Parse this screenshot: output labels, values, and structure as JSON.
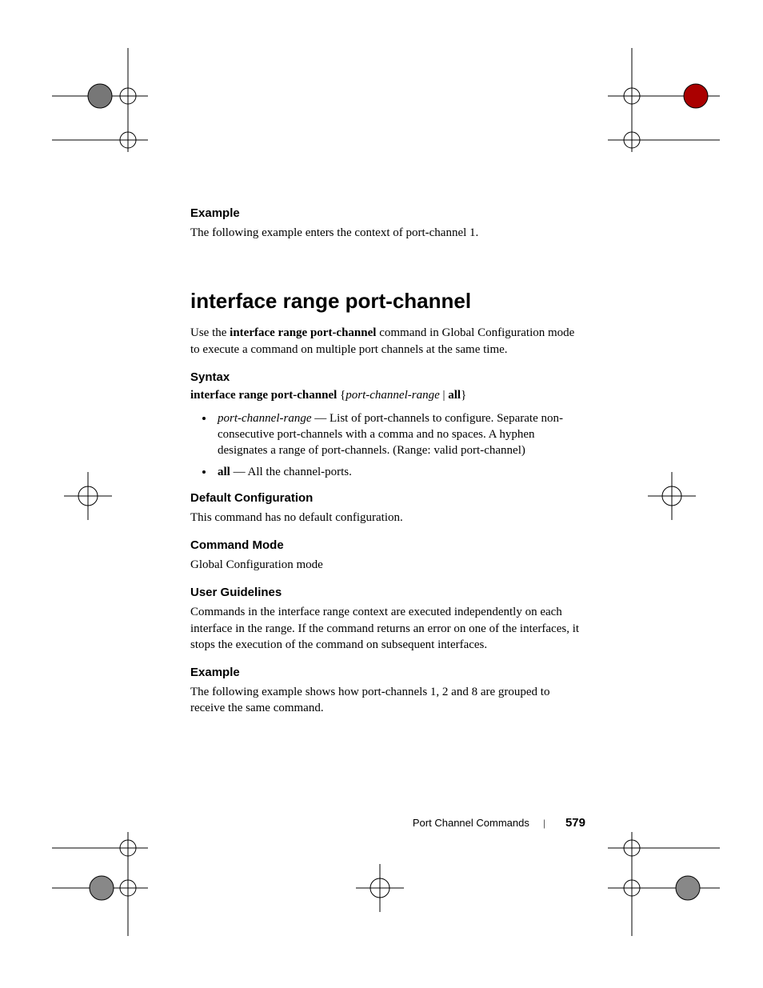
{
  "section1": {
    "heading": "Example",
    "text": "The following example enters the context of port-channel 1."
  },
  "command": {
    "title": "interface range port-channel",
    "intro_prefix": "Use the ",
    "intro_bold": "interface range port-channel",
    "intro_suffix": " command in Global Configuration mode to execute a command on multiple port channels at the same time."
  },
  "syntax": {
    "heading": "Syntax",
    "cmd_bold": "interface range port-channel",
    "open": " {",
    "param_italic": "port-channel-range",
    "pipe": " | ",
    "all_bold": "all",
    "close": "}",
    "bullet1_term": "port-channel-range",
    "bullet1_rest": " — List of port-channels to configure. Separate non-consecutive port-channels with a comma and no spaces. A hyphen designates a range of port-channels. (Range: valid port-channel)",
    "bullet2_term": "all",
    "bullet2_rest": " — All the channel-ports."
  },
  "defaultcfg": {
    "heading": "Default Configuration",
    "text": "This command has no default configuration."
  },
  "cmdmode": {
    "heading": "Command Mode",
    "text": "Global Configuration mode"
  },
  "guidelines": {
    "heading": "User Guidelines",
    "text": "Commands in the interface range context are executed independently on each interface in the range. If the command returns an error on one of the interfaces, it stops the execution of the command on subsequent interfaces."
  },
  "example2": {
    "heading": "Example",
    "text": "The following example shows how port-channels 1, 2 and 8 are grouped to receive the same command."
  },
  "footer": {
    "chapter": "Port Channel Commands",
    "sep": "|",
    "page": "579"
  }
}
